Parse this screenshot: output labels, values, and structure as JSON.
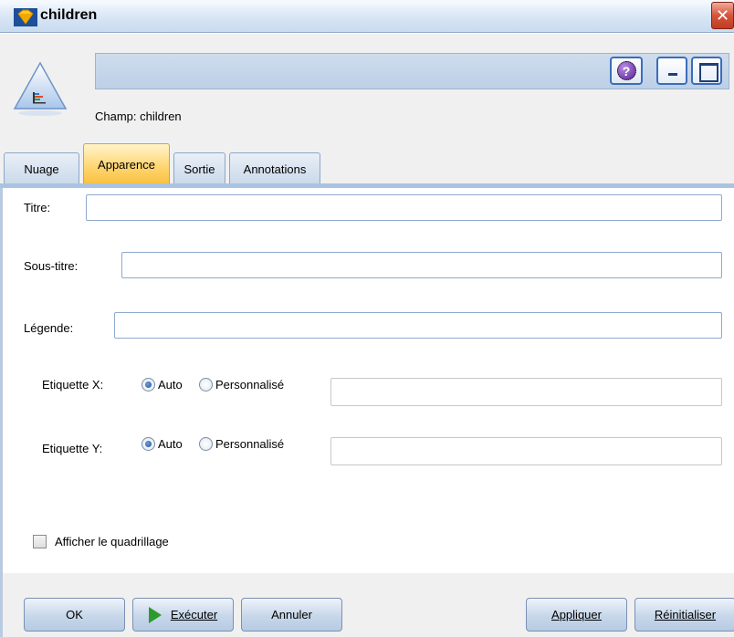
{
  "window": {
    "title": "children",
    "close_glyph": "✕",
    "help_glyph": "?"
  },
  "header": {
    "field_label": "Champ: children"
  },
  "tabs": [
    {
      "label": "Nuage"
    },
    {
      "label": "Apparence"
    },
    {
      "label": "Sortie"
    },
    {
      "label": "Annotations"
    }
  ],
  "form": {
    "title_label": "Titre:",
    "title_value": "",
    "subtitle_label": "Sous-titre:",
    "subtitle_value": "",
    "caption_label": "Légende:",
    "caption_value": "",
    "x_label": "Etiquette X:",
    "y_label": "Etiquette Y:",
    "auto_label": "Auto",
    "custom_label": "Personnalisé",
    "x_custom_value": "",
    "y_custom_value": "",
    "grid_label": "Afficher le quadrillage",
    "grid_checked": false,
    "x_mode": "Auto",
    "y_mode": "Auto"
  },
  "buttons": {
    "ok": "OK",
    "run": "Exécuter",
    "cancel": "Annuler",
    "apply": "Appliquer",
    "reset": "Réinitialiser"
  }
}
